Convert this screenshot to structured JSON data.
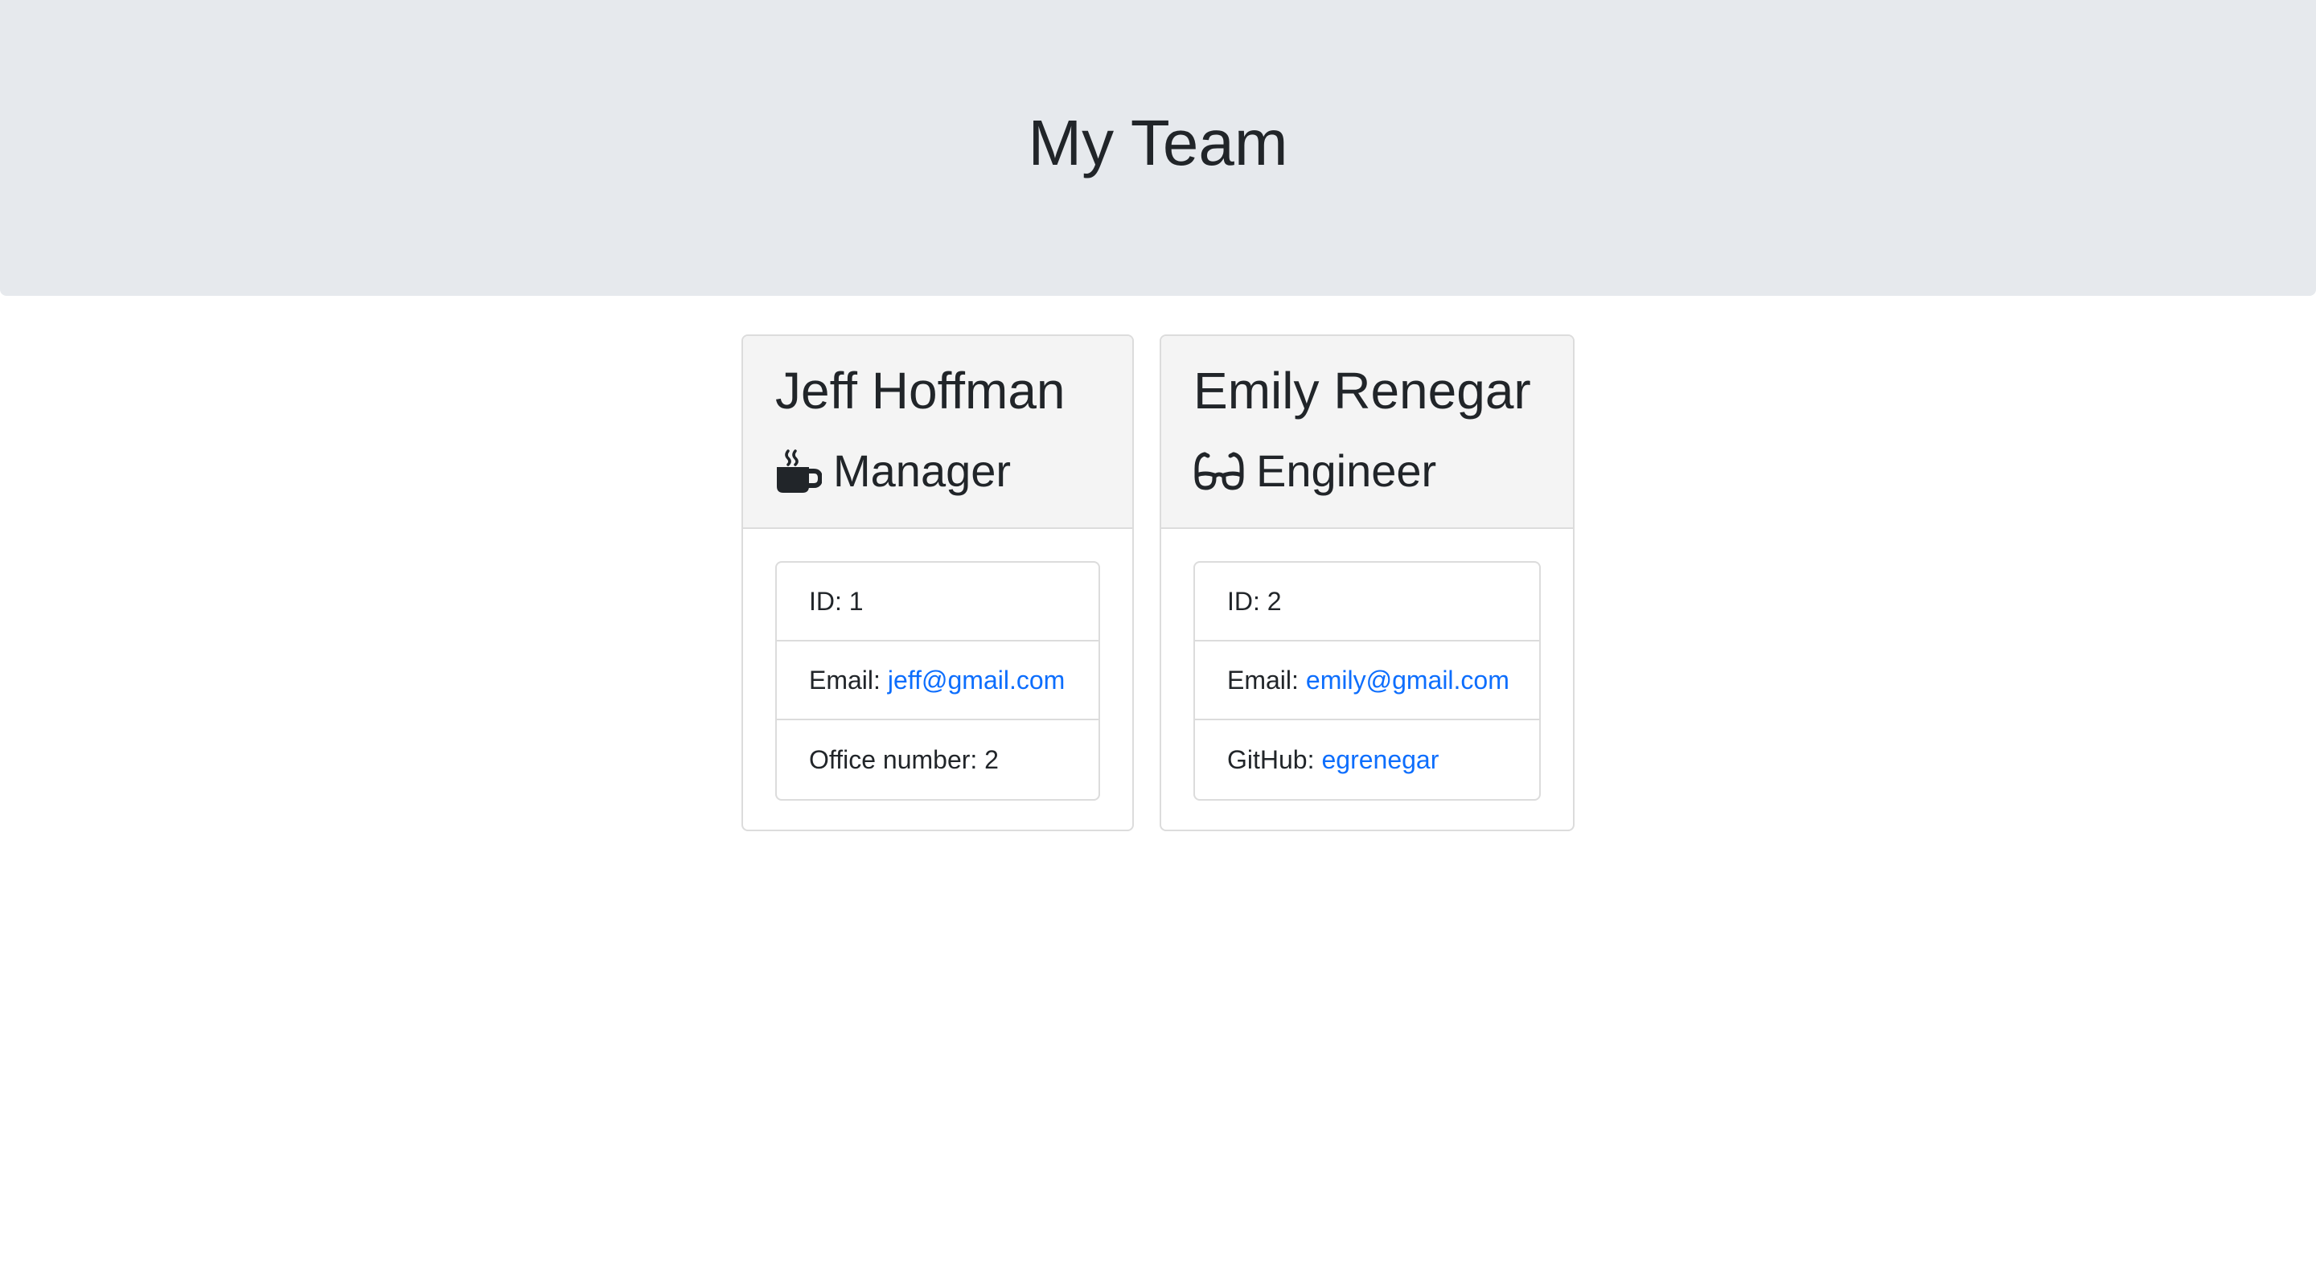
{
  "header": {
    "title": "My Team"
  },
  "employees": [
    {
      "name": "Jeff Hoffman",
      "role": "Manager",
      "role_icon": "mug-hot-icon",
      "id_label": "ID:",
      "id": "1",
      "email_label": "Email:",
      "email": "jeff@gmail.com",
      "extra_label": "Office number:",
      "extra_value": "2"
    },
    {
      "name": "Emily Renegar",
      "role": "Engineer",
      "role_icon": "glasses-icon",
      "id_label": "ID:",
      "id": "2",
      "email_label": "Email:",
      "email": "emily@gmail.com",
      "extra_label": "GitHub:",
      "extra_value": "egrenegar"
    }
  ],
  "colors": {
    "jumbotron_bg": "#e6e9ed",
    "card_header_bg": "#f4f4f4",
    "link": "#0d6efd",
    "text": "#212529",
    "border": "#dcdcdc"
  }
}
